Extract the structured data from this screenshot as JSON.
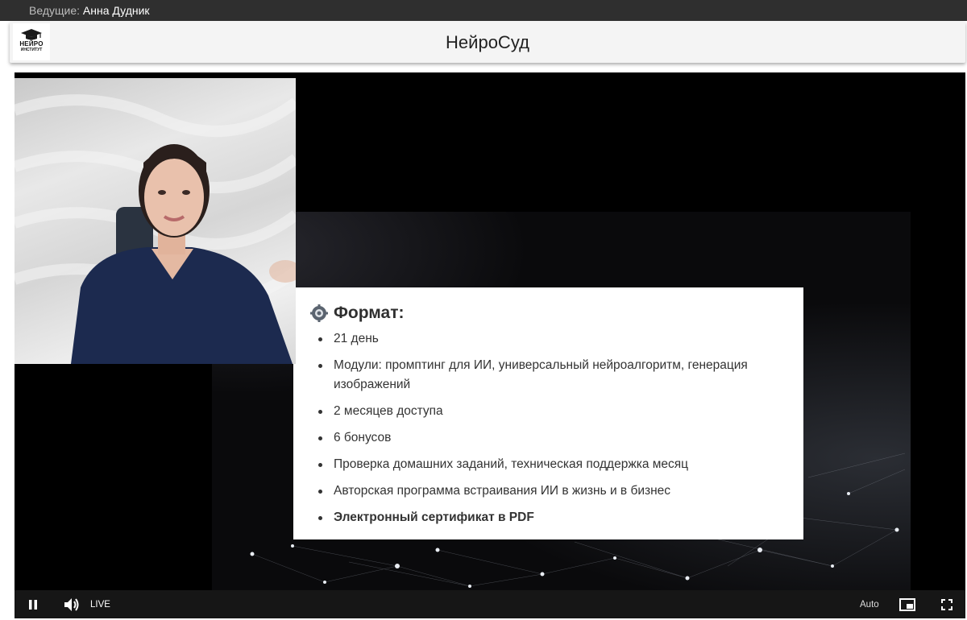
{
  "topbar": {
    "host_label": "Ведущие:",
    "host_name": "Анна Дудник"
  },
  "header": {
    "logo_line1": "НЕЙРО",
    "logo_line2": "ИНСТИТУТ",
    "title": "НейроСуд"
  },
  "slide": {
    "heading": "Формат:",
    "items": [
      "21 день",
      "Модули: промптинг для ИИ, универсальный нейроалгоритм, генерация изображений",
      "2 месяцев доступа",
      "6 бонусов",
      "Проверка домашних заданий, техническая поддержка месяц",
      "Авторская программа встраивания ИИ в жизнь и в бизнес",
      "Электронный сертификат в PDF"
    ]
  },
  "controls": {
    "live_label": "LIVE",
    "quality_label": "Auto",
    "icons": [
      "pause-icon",
      "volume-icon",
      "picture-in-picture-icon",
      "fullscreen-icon"
    ]
  },
  "colors": {
    "topbar": "#2f2f2f",
    "header": "#f4f4f4",
    "player": "#000000",
    "controls": "#161616"
  }
}
